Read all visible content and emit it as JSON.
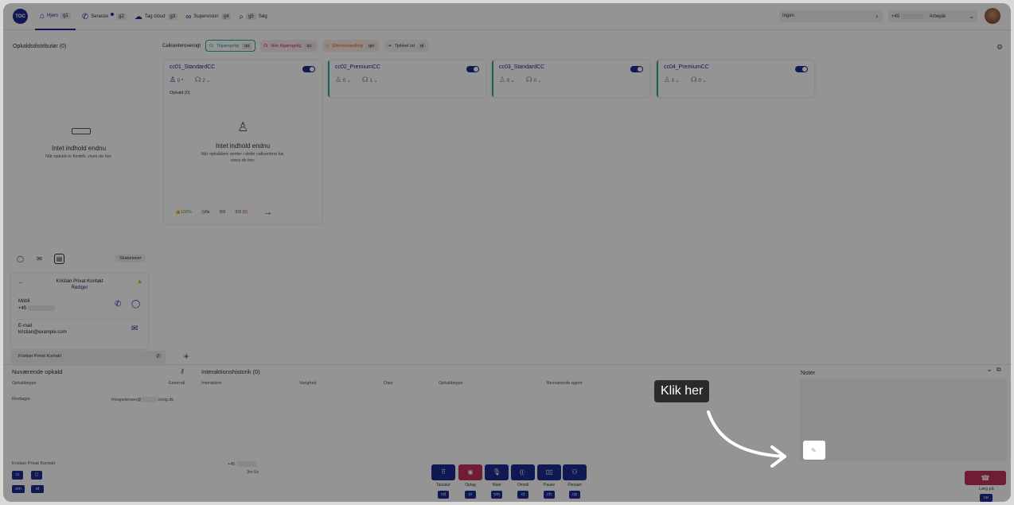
{
  "topbar": {
    "logo": "TOC",
    "nav": [
      {
        "label": "Hjem",
        "key": "g1"
      },
      {
        "label": "Seneste",
        "key": "g2"
      },
      {
        "label": "Tag cloud",
        "key": "g3"
      },
      {
        "label": "Supervision",
        "key": "g4"
      },
      {
        "label": "Søg",
        "key": "g5"
      }
    ],
    "status_value": "Ingen",
    "phone_prefix": "+45",
    "phone_status": "Arbejde"
  },
  "left": {
    "title": "Opkaldsdistributør (0)",
    "empty_title": "Intet indhold endnu",
    "empty_sub": "Når opkald er fordelt, vises de her."
  },
  "cc": {
    "overview_label": "Callcenteroversigt",
    "filters": [
      {
        "label": "Tilgængelig",
        "key": "qa"
      },
      {
        "label": "Ikke tilgængelig",
        "key": "qu"
      },
      {
        "label": "Efterbehandling",
        "key": "qw"
      },
      {
        "label": "Tjekket ud",
        "key": "ql"
      }
    ],
    "cards": [
      {
        "name": "cc01_StandardCC",
        "agents": "0",
        "waiting": "2"
      },
      {
        "name": "cc02_PremiumCC",
        "agents": "0",
        "waiting": "1"
      },
      {
        "name": "cc03_StandardCC",
        "agents": "0",
        "waiting": "0"
      },
      {
        "name": "cc04_PremiumCC",
        "agents": "0",
        "waiting": "0"
      }
    ],
    "calls_label": "Opkald (0)",
    "empty_title": "Intet indhold endnu",
    "empty_sub": "Når opkaldere venter i dette callcenters kø, vises de her.",
    "footer": {
      "rate": "100%",
      "time": "0s",
      "calls": "0",
      "missed": "0",
      "missed_count": "(0)"
    }
  },
  "contact": {
    "templates_label": "Skabeloner",
    "name": "Kristian Privat Kontakt",
    "edit": "Rediger",
    "mobile_label": "Mobil",
    "mobile_prefix": "+45",
    "email_label": "E-mail",
    "email": "kristian@example.com",
    "tab_label": "Kristian Privat Kontakt"
  },
  "current_call": {
    "title": "Nuværende opkald",
    "type_label": "Opkaldstype",
    "type_value": "External",
    "receiver_label": "Modtager",
    "receiver_value": "freiapetersen@",
    "receiver_domain": ".tvoip.dk",
    "caller_name": "Kristian Privat Kontakt",
    "caller_prefix": "+45",
    "duration": "3m 5s",
    "key_om": "om",
    "key_ot": "ot"
  },
  "history": {
    "title": "Interaktionshistorik (0)",
    "columns": [
      "Interaktion",
      "Varighed",
      "Dato",
      "Opkaldstype",
      "Besvarende agent"
    ]
  },
  "notes": {
    "title": "Noter"
  },
  "controls": [
    {
      "label": "Tastatur",
      "key": "cd"
    },
    {
      "label": "Optag",
      "key": "cr"
    },
    {
      "label": "Mute",
      "key": "cm"
    },
    {
      "label": "Omstil",
      "key": "ct"
    },
    {
      "label": "Pause",
      "key": "ch"
    },
    {
      "label": "Flerpart",
      "key": "cp"
    }
  ],
  "hangup": {
    "label": "Læg på",
    "key": "ce"
  },
  "tooltip": {
    "text": "Klik her"
  }
}
